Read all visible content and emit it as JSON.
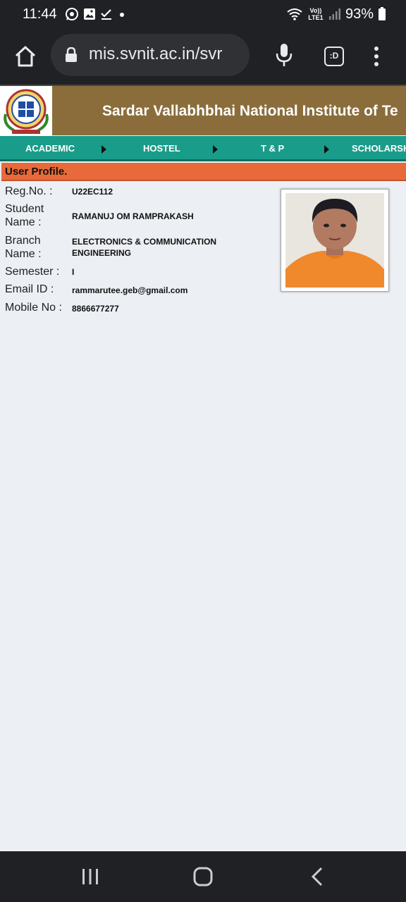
{
  "status_bar": {
    "time": "11:44",
    "network_label": "Vo)) LTE1",
    "battery": "93%"
  },
  "browser": {
    "url": "mis.svnit.ac.in/svr",
    "tabs_label": ":D"
  },
  "site": {
    "institute_title": "Sardar Vallabhbhai National Institute of Te",
    "nav": [
      "ACADEMIC",
      "HOSTEL",
      "T & P",
      "SCHOLARSH"
    ]
  },
  "profile": {
    "heading": "User Profile.",
    "fields": [
      {
        "label": "Reg.No. :",
        "value": "U22EC112"
      },
      {
        "label": "Student Name :",
        "value": "RAMANUJ OM RAMPRAKASH"
      },
      {
        "label": "Branch Name :",
        "value": "ELECTRONICS & COMMUNICATION ENGINEERING"
      },
      {
        "label": "Semester :",
        "value": "I"
      },
      {
        "label": "Email ID :",
        "value": "rammarutee.geb@gmail.com"
      },
      {
        "label": "Mobile No :",
        "value": "8866677277"
      }
    ]
  },
  "colors": {
    "header_bg": "#8a6d3b",
    "nav_bg": "#1a9c8a",
    "profile_bar": "#e86a3a",
    "page_bg": "#eceff4"
  }
}
